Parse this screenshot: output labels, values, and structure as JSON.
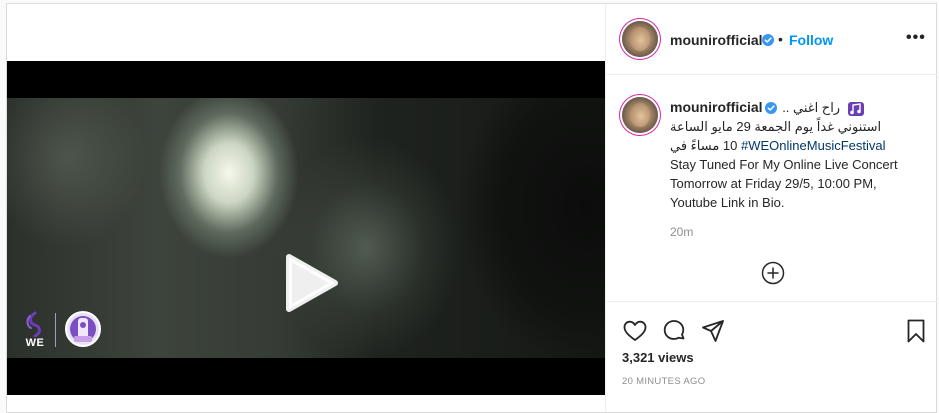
{
  "post": {
    "username": "mounirofficial",
    "verified": true,
    "follow_label": "Follow",
    "separator": "•",
    "more_label": "•••",
    "caption": {
      "line1_rtl": "راح اغني ..",
      "line2_rtl": "استنوني غداً يوم الجمعة 29 مايو الساعة",
      "line3_rtl_prefix": "10 مساءً في",
      "hashtag": "#WEOnlineMusicFestival",
      "english": "Stay Tuned For My Online Live Concert Tomorrow at Friday 29/5, 10:00 PM, Youtube Link in Bio."
    },
    "time_ago": "20m",
    "views": "3,321 views",
    "timestamp": "20 MINUTES AGO"
  },
  "video": {
    "brand_we_text": "WE",
    "play_icon": "play-icon"
  },
  "icons": {
    "verified": "verified-badge-icon",
    "more": "more-options-icon",
    "add_comment": "add-comment-icon",
    "like": "heart-icon",
    "comment": "comment-icon",
    "share": "share-icon",
    "save": "bookmark-icon"
  },
  "colors": {
    "link": "#0095f6",
    "hashtag": "#00376b",
    "secondary_text": "#8e8e8e",
    "story_ring": "#d6249f",
    "border": "#dbdbdb"
  }
}
